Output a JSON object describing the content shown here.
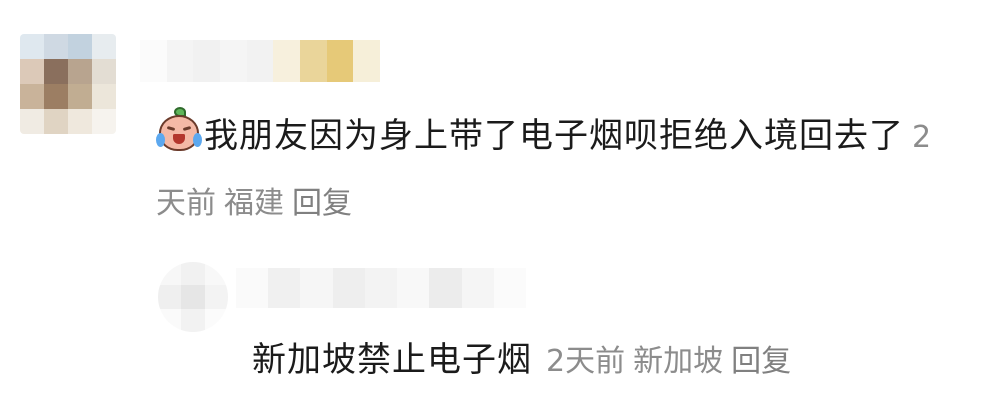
{
  "comment": {
    "avatar_icon": "pixelated-avatar",
    "emoji_icon": "crying-face-emoji",
    "text": "我朋友因为身上带了电子烟呗拒绝入境回去了",
    "time": "2天前",
    "location": "福建",
    "reply_label": "回复"
  },
  "reply": {
    "avatar_icon": "pixelated-avatar",
    "text": "新加坡禁止电子烟",
    "time": "2天前",
    "location": "新加坡",
    "reply_label": "回复"
  },
  "colors": {
    "text": "#1b1b1b",
    "meta": "#8c8c8c",
    "background": "#ffffff"
  }
}
